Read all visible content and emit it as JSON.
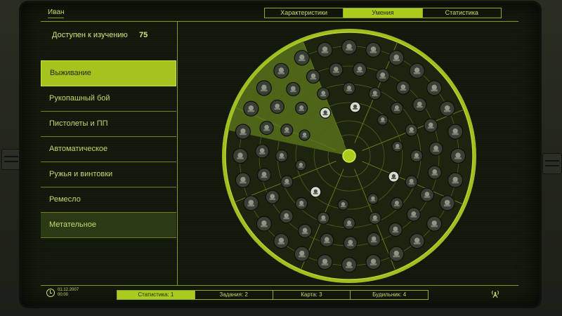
{
  "player": {
    "name": "Иван"
  },
  "tabs": [
    {
      "label": "Характеристики",
      "active": false
    },
    {
      "label": "Умения",
      "active": true
    },
    {
      "label": "Статистика",
      "active": false
    }
  ],
  "skill_points": {
    "label": "Доступен к изучению",
    "value": "75"
  },
  "skill_categories": [
    {
      "label": "Выживание",
      "state": "selected"
    },
    {
      "label": "Рукопашный бой",
      "state": "normal"
    },
    {
      "label": "Пистолеты и ПП",
      "state": "normal"
    },
    {
      "label": "Автоматическое",
      "state": "normal"
    },
    {
      "label": "Ружья и винтовки",
      "state": "normal"
    },
    {
      "label": "Ремесло",
      "state": "normal"
    },
    {
      "label": "Метательное",
      "state": "highlighted"
    }
  ],
  "skill_wheel": {
    "rings": [
      {
        "count": 28,
        "icon": "skill-perk-icon"
      },
      {
        "count": 23,
        "icon": "skill-perk-icon"
      },
      {
        "count": 16,
        "icon": "skill-perk-icon"
      },
      {
        "count": 10,
        "icon": "skill-perk-icon"
      }
    ],
    "sectors": 8,
    "highlighted_sector": "Выживание"
  },
  "status_bar": [
    {
      "label": "Статистика: 1",
      "active": true
    },
    {
      "label": "Задания: 2",
      "active": false
    },
    {
      "label": "Карта: 3",
      "active": false
    },
    {
      "label": "Будильник: 4",
      "active": false
    }
  ],
  "datetime": {
    "date": "01.12.2007",
    "time": "00:00"
  },
  "colors": {
    "accent": "#a9cc1f",
    "text": "#c8d86a",
    "screen": "#141a0d"
  }
}
